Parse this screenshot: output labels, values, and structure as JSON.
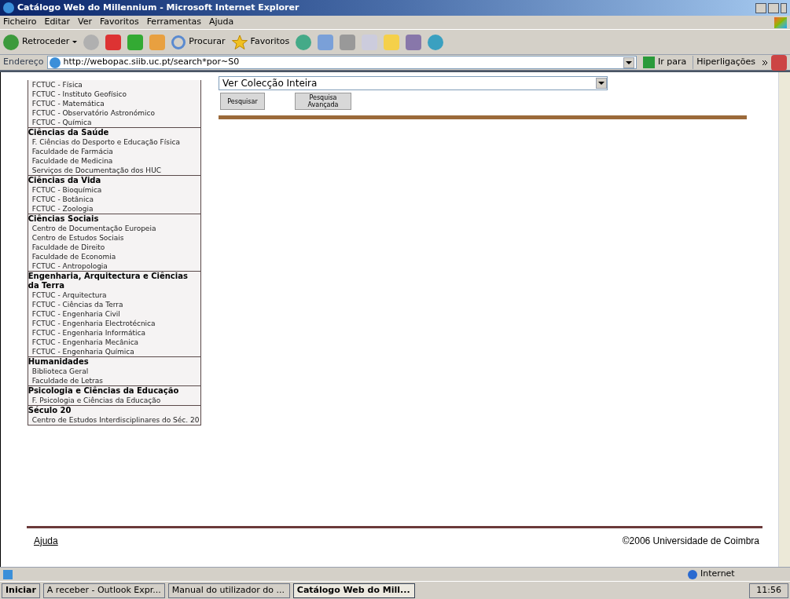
{
  "window": {
    "title": "Catálogo Web do Millennium - Microsoft Internet Explorer"
  },
  "menu": [
    "Ficheiro",
    "Editar",
    "Ver",
    "Favoritos",
    "Ferramentas",
    "Ajuda"
  ],
  "toolbar": {
    "back": "Retroceder",
    "search": "Procurar",
    "favorites": "Favoritos"
  },
  "address_bar": {
    "label": "Endereço",
    "url": "http://webopac.siib.uc.pt/search*por~S0",
    "go": "Ir para",
    "links": "Hiperligações"
  },
  "sidebar": {
    "groups": [
      {
        "items": [
          "FCTUC - Física",
          "FCTUC - Instituto Geofísico",
          "FCTUC - Matemática",
          "FCTUC - Observatório Astronómico",
          "FCTUC - Química"
        ]
      },
      {
        "heading": "Ciências da Saúde",
        "items": [
          "F. Ciências do Desporto e Educação Física",
          "Faculdade de Farmácia",
          "Faculdade de Medicina",
          "Serviços de Documentação dos HUC"
        ]
      },
      {
        "heading": "Ciências da Vida",
        "items": [
          "FCTUC - Bioquímica",
          "FCTUC - Botânica",
          "FCTUC - Zoologia"
        ]
      },
      {
        "heading": "Ciências Sociais",
        "items": [
          "Centro de Documentação Europeia",
          "Centro de Estudos Sociais",
          "Faculdade de Direito",
          "Faculdade de Economia",
          "FCTUC - Antropologia"
        ]
      },
      {
        "heading": "Engenharia, Arquitectura e Ciências da Terra",
        "items": [
          "FCTUC - Arquitectura",
          "FCTUC - Ciências da Terra",
          "FCTUC - Engenharia Civil",
          "FCTUC - Engenharia Electrotécnica",
          "FCTUC - Engenharia Informática",
          "FCTUC - Engenharia Mecânica",
          "FCTUC - Engenharia Química"
        ]
      },
      {
        "heading": "Humanidades",
        "items": [
          "Biblioteca Geral",
          "Faculdade de Letras"
        ]
      },
      {
        "heading": "Psicologia e Ciências da Educação",
        "items": [
          "F. Psicologia e Ciências da Educação"
        ]
      },
      {
        "heading": "Século 20",
        "items": [
          "Centro de Estudos Interdisciplinares do Séc. 20"
        ]
      }
    ]
  },
  "search": {
    "collection": "Ver Colecção Inteira",
    "buttons": [
      "Pesquisar",
      "Pesquisa Avançada"
    ]
  },
  "footer": {
    "link": "Ajuda",
    "copyright": "©2006 Universidade de Coimbra"
  },
  "status_bar": {
    "zone": "Internet"
  },
  "taskbar": {
    "start": "Iniciar",
    "items": [
      {
        "label": "A receber - Outlook Expr...",
        "selected": false
      },
      {
        "label": "Manual do utilizador do ...",
        "selected": false
      },
      {
        "label": "Catálogo Web do Mill...",
        "selected": true
      }
    ],
    "clock": "11:56"
  }
}
